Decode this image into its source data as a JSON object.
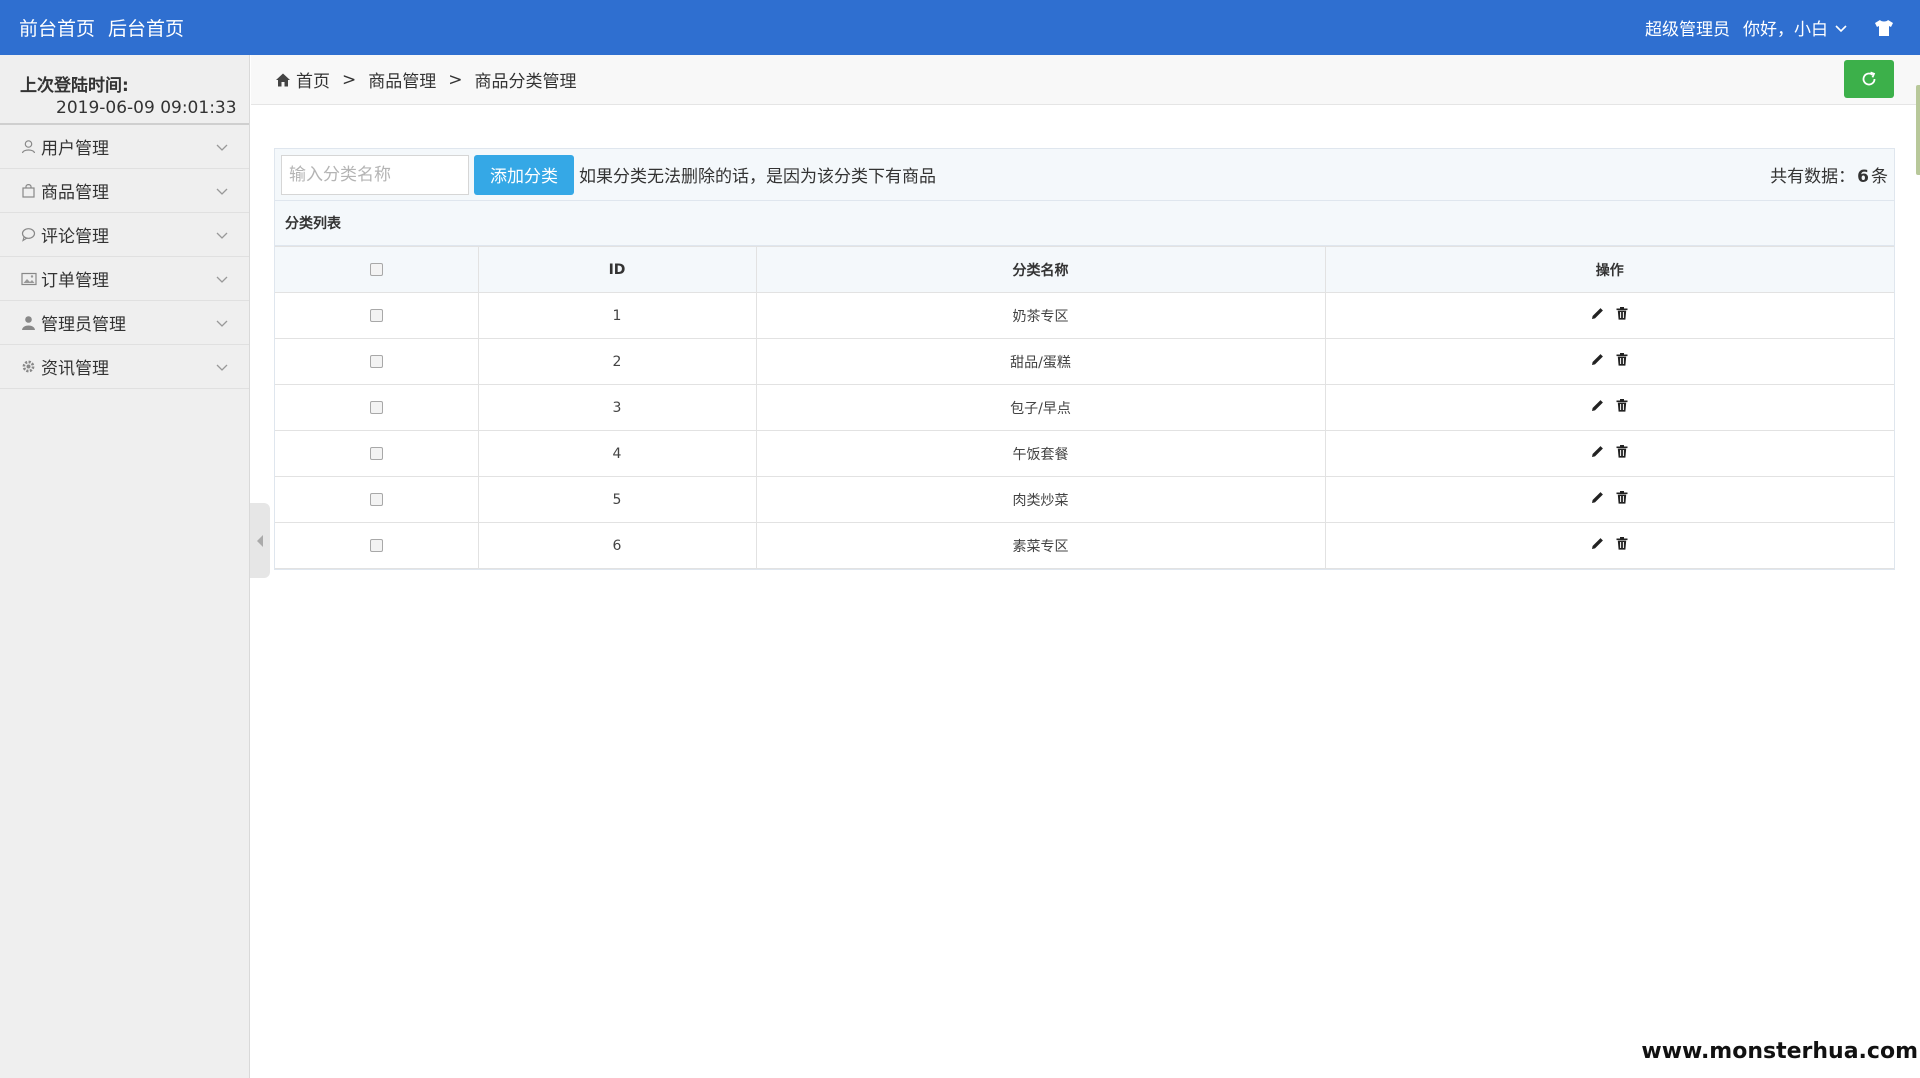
{
  "topbar": {
    "front_home": "前台首页",
    "back_home": "后台首页",
    "role": "超级管理员",
    "greeting": "你好，小白"
  },
  "sidebar": {
    "last_login_label": "上次登陆时间:",
    "last_login_value": "2019-06-09 09:01:33",
    "items": [
      {
        "label": "用户管理",
        "icon": "user-outline-icon"
      },
      {
        "label": "商品管理",
        "icon": "shopping-bag-icon"
      },
      {
        "label": "评论管理",
        "icon": "comment-icon"
      },
      {
        "label": "订单管理",
        "icon": "image-icon"
      },
      {
        "label": "管理员管理",
        "icon": "user-solid-icon"
      },
      {
        "label": "资讯管理",
        "icon": "gear-icon"
      }
    ]
  },
  "breadcrumb": {
    "home": "首页",
    "sep": ">",
    "level1": "商品管理",
    "level2": "商品分类管理"
  },
  "toolbar": {
    "search_placeholder": "输入分类名称",
    "add_label": "添加分类",
    "tip": "如果分类无法删除的话，是因为该分类下有商品",
    "count_prefix": "共有数据：",
    "count_value": "6",
    "count_suffix": "条"
  },
  "list": {
    "title": "分类列表",
    "headers": {
      "id": "ID",
      "name": "分类名称",
      "ops": "操作"
    },
    "rows": [
      {
        "id": "1",
        "name": "奶茶专区"
      },
      {
        "id": "2",
        "name": "甜品/蛋糕"
      },
      {
        "id": "3",
        "name": "包子/早点"
      },
      {
        "id": "4",
        "name": "午饭套餐"
      },
      {
        "id": "5",
        "name": "肉类炒菜"
      },
      {
        "id": "6",
        "name": "素菜专区"
      }
    ]
  },
  "watermark": "www.monsterhua.com",
  "colors": {
    "topbar": "#2f6fd0",
    "add_button": "#35a8e6",
    "refresh_button": "#3cb04a"
  }
}
